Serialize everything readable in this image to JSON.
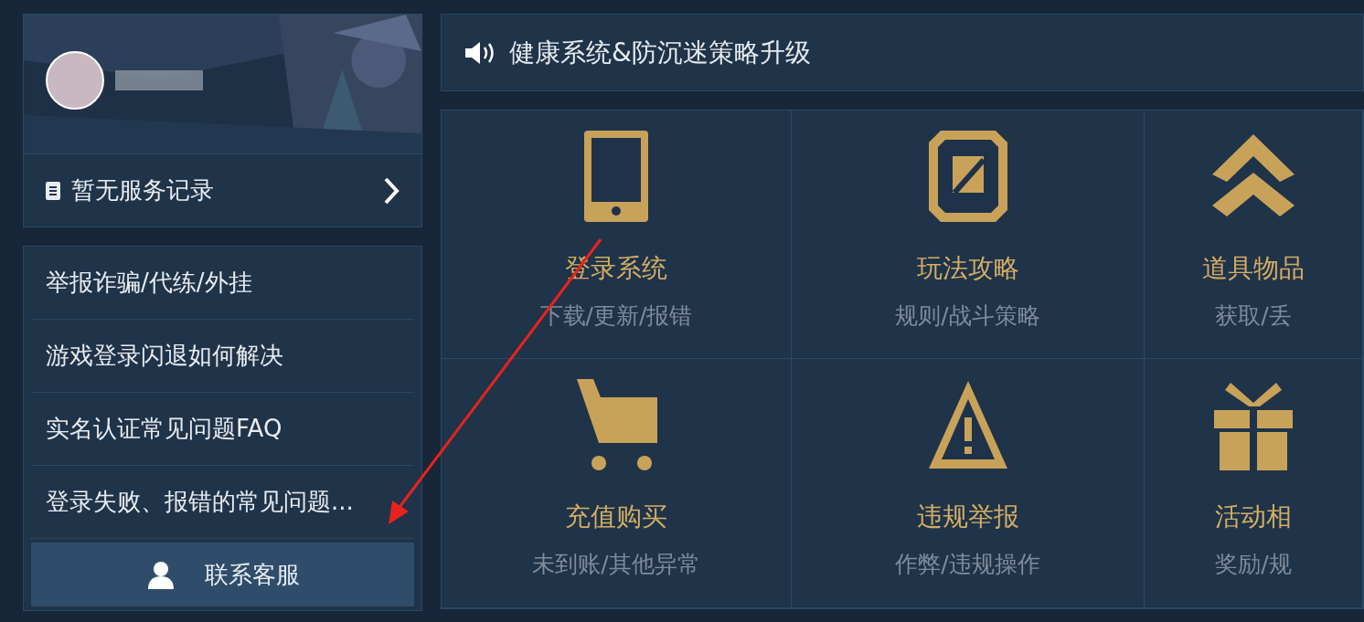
{
  "service_record": {
    "label": "暂无服务记录"
  },
  "faq": [
    {
      "text": "举报诈骗/代练/外挂"
    },
    {
      "text": "游戏登录闪退如何解决"
    },
    {
      "text": "实名认证常见问题FAQ"
    },
    {
      "text": "登录失败、报错的常见问题..."
    }
  ],
  "contact_button": {
    "label": "联系客服"
  },
  "notice": {
    "text": "健康系统&防沉迷策略升级"
  },
  "categories": [
    {
      "kind": "phone",
      "title": "登录系统",
      "subtitle": "下载/更新/报错"
    },
    {
      "kind": "guide",
      "title": "玩法攻略",
      "subtitle": "规则/战斗策略"
    },
    {
      "kind": "items",
      "title": "道具物品",
      "subtitle": "获取/丢"
    },
    {
      "kind": "cart",
      "title": "充值购买",
      "subtitle": "未到账/其他异常"
    },
    {
      "kind": "warning",
      "title": "违规举报",
      "subtitle": "作弊/违规操作"
    },
    {
      "kind": "gift",
      "title": "活动相",
      "subtitle": "奖励/规"
    }
  ]
}
